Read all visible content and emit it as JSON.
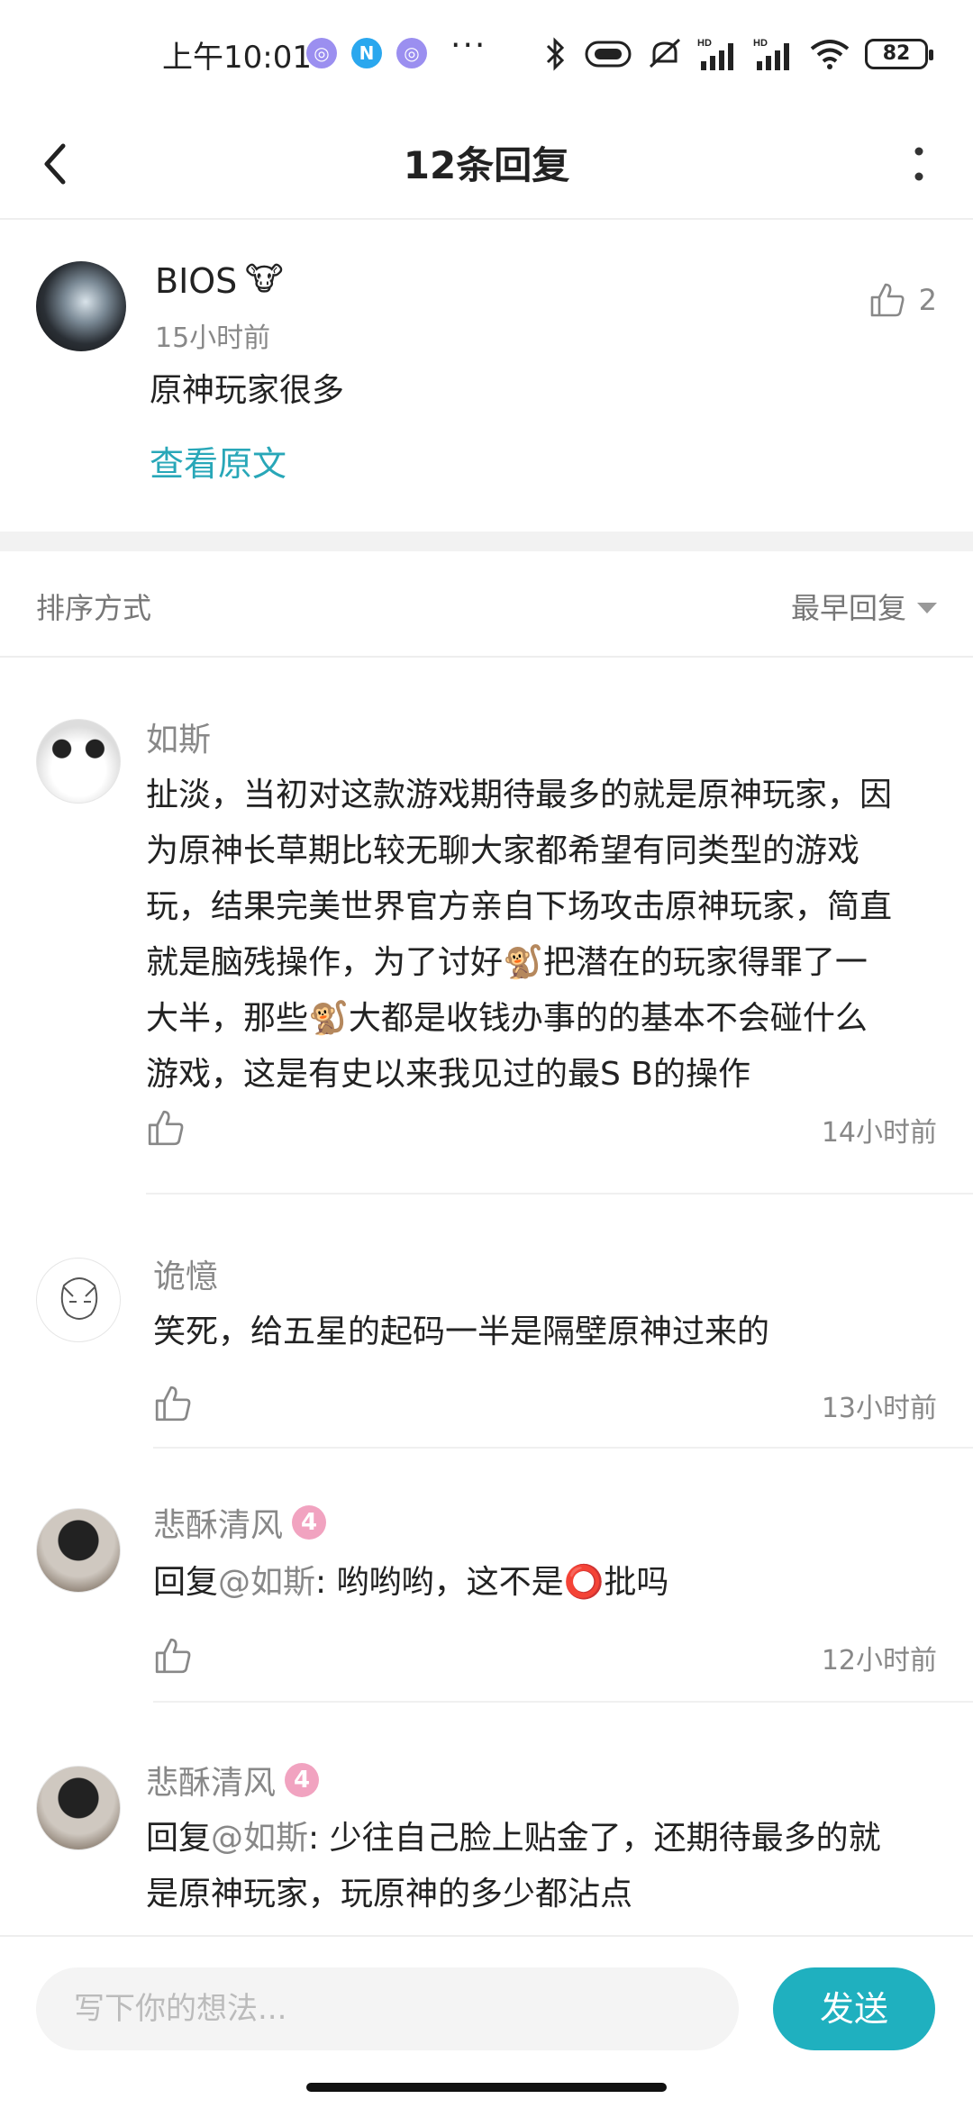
{
  "status_bar": {
    "time": "上午10:01",
    "apps": [
      {
        "icon": "app-notify-icon",
        "glyph": "◎",
        "color": "#9b8ff0"
      },
      {
        "icon": "n-app-icon",
        "glyph": "N",
        "color": "#2aa7ee"
      },
      {
        "icon": "app-notify-icon",
        "glyph": "◎",
        "color": "#9b8ff0"
      }
    ],
    "more": "···",
    "icons": [
      "bluetooth-icon",
      "vibrate-icon",
      "mute-icon",
      "signal-hd-icon",
      "signal-hd-icon",
      "wifi-icon"
    ],
    "hd_label": "HD",
    "battery": "82"
  },
  "header": {
    "title": "12条回复",
    "back_icon": "chevron-left-icon",
    "more_icon": "more-vertical-icon"
  },
  "original": {
    "name": "BIOS",
    "badge": "🐮",
    "time": "15小时前",
    "text": "原神玩家很多",
    "view_original": "查看原文",
    "likes": "2"
  },
  "sort": {
    "label": "排序方式",
    "selected": "最早回复"
  },
  "replies": [
    {
      "name": "如斯",
      "level": "",
      "text_lines": [
        "扯淡，当初对这款游戏期待最多的就是原神玩家，因",
        "为原神长草期比较无聊大家都希望有同类型的游戏",
        "玩，结果完美世界官方亲自下场攻击原神玩家，简直",
        "就是脑残操作，为了讨好🐒把潜在的玩家得罪了一",
        "大半，那些🐒大都是收钱办事的的基本不会碰什么",
        "游戏，这是有史以来我见过的最S B的操作"
      ],
      "time": "14小时前"
    },
    {
      "name": "诡憶",
      "level": "",
      "text": "笑死，给五星的起码一半是隔壁原神过来的",
      "time": "13小时前"
    },
    {
      "name": "悲酥清风",
      "level": "4",
      "reply_prefix": "回复",
      "mention": "@如斯",
      "text": ": 哟哟哟，这不是⭕批吗",
      "time": "12小时前"
    },
    {
      "name": "悲酥清风",
      "level": "4",
      "reply_prefix": "回复",
      "mention": "@如斯",
      "text_line1": ": 少往自己脸上贴金了，还期待最多的就",
      "text_line2": "是原神玩家，玩原神的多少都沾点"
    }
  ],
  "input": {
    "placeholder": "写下你的想法...",
    "send": "发送"
  },
  "colors": {
    "accent": "#1fb0bf",
    "link": "#28a7b8",
    "level_badge": "#f1a3c0"
  }
}
